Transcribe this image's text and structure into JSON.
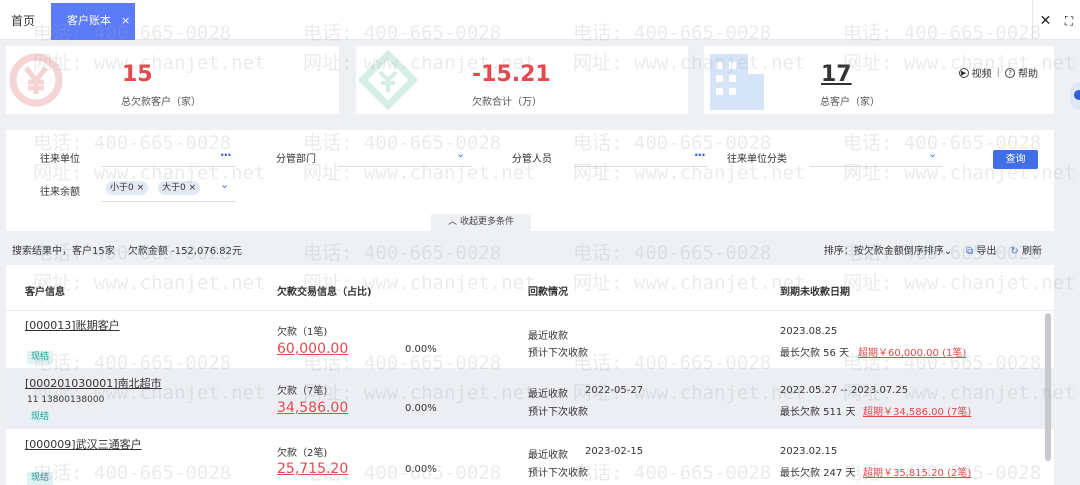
{
  "tabs": {
    "home": "首页",
    "active": "客户账本",
    "close": "×"
  },
  "window": {
    "close": "✕",
    "fullscreen": "⛶"
  },
  "summary": {
    "overdue_customers": {
      "value": "15",
      "label": "总欠款客户（家）",
      "color": "#e5484d"
    },
    "debt_total": {
      "value": "-15.21",
      "label": "欠款合计（万）",
      "color": "#e5484d"
    },
    "total_customers": {
      "value": "17",
      "label": "总客户（家）",
      "color": "#333333"
    },
    "video_label": "视频",
    "help_label": "帮助"
  },
  "filters": {
    "counterparty_label": "往来单位",
    "department_label": "分管部门",
    "staff_label": "分管人员",
    "category_label": "往来单位分类",
    "balance_label": "往来余额",
    "chips": [
      "小于0 ×",
      "大于0 ×"
    ],
    "query_button": "查询",
    "collapse_label": "收起更多条件"
  },
  "results": {
    "summary_text": "搜索结果中，客户15家",
    "amount_text": "欠款金额 -152,076.82元",
    "sort_label": "排序：按欠款金额倒序排序",
    "export_label": "导出",
    "refresh_label": "刷新"
  },
  "table": {
    "headers": [
      "客户信息",
      "欠款交易信息（占比)",
      "回款情况",
      "到期未收款日期"
    ],
    "rows": [
      {
        "name": "[000013]账期客户",
        "phone": "",
        "badge": "现结",
        "debt_count": "欠款（1笔)",
        "debt_amount": "60,000.00",
        "pct": "0.00%",
        "recent_label": "最近收款",
        "recent_date": "",
        "next_label": "预计下次收款",
        "due_range": "2023.08.25",
        "longest": "最长欠款 56 天",
        "overdue": "超期￥60,000.00 (1笔)"
      },
      {
        "name": "[000201030001]南北超市",
        "phone": "11    13800138000",
        "badge": "现结",
        "debt_count": "欠款（7笔)",
        "debt_amount": "34,586.00",
        "pct": "0.00%",
        "recent_label": "最近收款",
        "recent_date": "2022-05-27",
        "next_label": "预计下次收款",
        "due_range": "2022.05.27 -- 2023.07.25",
        "longest": "最长欠款 511 天",
        "overdue": "超期￥34,586.00 (7笔)"
      },
      {
        "name": "[000009]武汉三通客户",
        "phone": "",
        "badge": "现结",
        "debt_count": "欠款（2笔)",
        "debt_amount": "25,715.20",
        "pct": "0.00%",
        "recent_label": "最近收款",
        "recent_date": "2023-02-15",
        "next_label": "预计下次收款",
        "due_range": "2023.02.15",
        "longest": "最长欠款 247 天",
        "overdue": "超期￥35,815.20 (2笔)"
      }
    ]
  },
  "watermark": {
    "phone": "电话: 400-665-0028",
    "site": "网址: www.chanjet.net"
  }
}
